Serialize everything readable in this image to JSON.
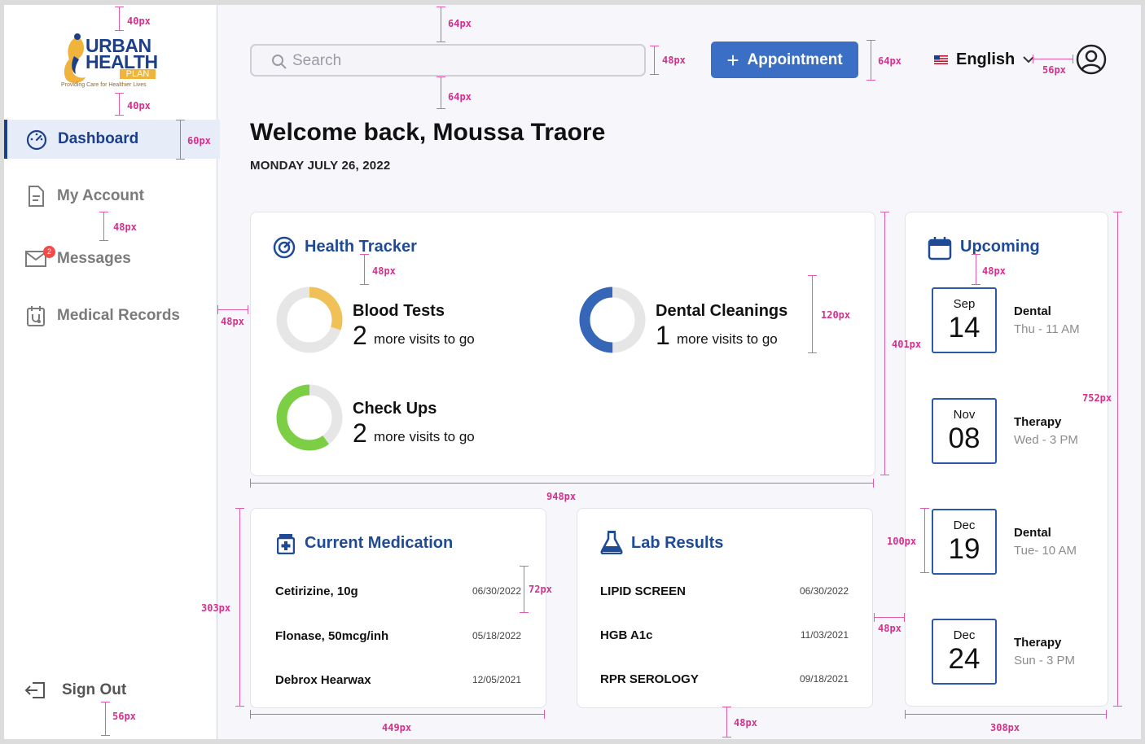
{
  "sidebar": {
    "logo": {
      "line1": "URBAN",
      "line2": "HEALTH",
      "line3": "PLAN",
      "tagline": "Providing Care for Healthier Lives"
    },
    "items": [
      {
        "label": "Dashboard",
        "icon": "dashboard-icon",
        "active": true
      },
      {
        "label": "My Account",
        "icon": "document-icon"
      },
      {
        "label": "Messages",
        "icon": "mail-icon",
        "badge": "2"
      },
      {
        "label": "Medical Records",
        "icon": "medical-records-icon"
      }
    ],
    "signout": {
      "label": "Sign Out",
      "icon": "sign-out-icon"
    }
  },
  "header": {
    "search_placeholder": "Search",
    "appointment_label": "Appointment",
    "language": "English"
  },
  "welcome": {
    "title": "Welcome back, Moussa Traore",
    "date": "MONDAY JULY 26, 2022"
  },
  "health_tracker": {
    "title": "Health Tracker",
    "items": [
      {
        "name": "Blood Tests",
        "count": "2",
        "suffix": "more visits to go",
        "color": "#f1c159",
        "progress": 0.3
      },
      {
        "name": "Dental Cleanings",
        "count": "1",
        "suffix": "more visits to go",
        "color": "#3566b8",
        "progress": 0.5
      },
      {
        "name": "Check Ups",
        "count": "2",
        "suffix": "more visits to go",
        "color": "#7ccf45",
        "progress": 0.6
      }
    ]
  },
  "medication": {
    "title": "Current Medication",
    "rows": [
      {
        "name": "Cetirizine, 10g",
        "date": "06/30/2022"
      },
      {
        "name": "Flonase, 50mcg/inh",
        "date": "05/18/2022"
      },
      {
        "name": "Debrox Hearwax",
        "date": "12/05/2021"
      }
    ]
  },
  "labs": {
    "title": "Lab Results",
    "rows": [
      {
        "name": "LIPID SCREEN",
        "date": "06/30/2022"
      },
      {
        "name": "HGB A1c",
        "date": "11/03/2021"
      },
      {
        "name": "RPR SEROLOGY",
        "date": "09/18/2021"
      }
    ]
  },
  "upcoming": {
    "title": "Upcoming",
    "items": [
      {
        "month": "Sep",
        "day": "14",
        "type": "Dental",
        "when": "Thu - 11 AM"
      },
      {
        "month": "Nov",
        "day": "08",
        "type": "Therapy",
        "when": "Wed - 3 PM"
      },
      {
        "month": "Dec",
        "day": "19",
        "type": "Dental",
        "when": "Tue- 10 AM"
      },
      {
        "month": "Dec",
        "day": "24",
        "type": "Therapy",
        "when": "Sun - 3 PM"
      }
    ]
  },
  "annotations": {
    "a40top": "40px",
    "a40b": "40px",
    "a60": "60px",
    "a48nav": "48px",
    "a56": "56px",
    "a64top": "64px",
    "a64bot": "64px",
    "a48search": "48px",
    "a64btn": "64px",
    "a56user": "56px",
    "a48left": "48px",
    "a48title": "48px",
    "a120": "120px",
    "a401": "401px",
    "a948": "948px",
    "a48up": "48px",
    "a752": "752px",
    "a100": "100px",
    "a48gap": "48px",
    "a303": "303px",
    "a72": "72px",
    "a449": "449px",
    "a48bottom": "48px",
    "a308": "308px"
  }
}
